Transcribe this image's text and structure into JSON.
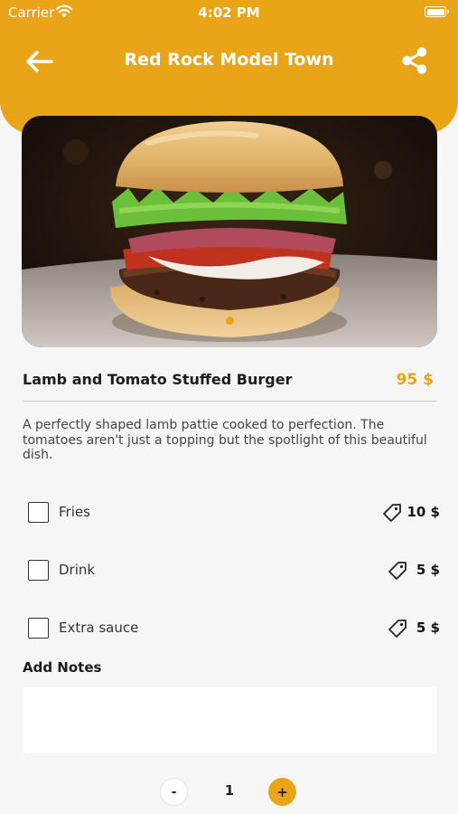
{
  "status_bar": {
    "carrier": "Carrier",
    "time": "4:02 PM"
  },
  "header": {
    "title": "Red Rock Model Town",
    "back_icon": "arrow-left-icon",
    "share_icon": "share-icon"
  },
  "colors": {
    "accent": "#eaa417",
    "background": "#f6f6f6"
  },
  "product": {
    "name": "Lamb and Tomato Stuffed Burger",
    "price": "95 $",
    "description": "A perfectly shaped lamb pattie cooked to perfection. The tomatoes aren't just a topping but the spotlight of this beautiful dish.",
    "image_icon": "burger-photo"
  },
  "addons": [
    {
      "label": "Fries",
      "price": "10 $",
      "checked": false
    },
    {
      "label": "Drink",
      "price": "5 $",
      "checked": false
    },
    {
      "label": "Extra sauce",
      "price": "5 $",
      "checked": false
    }
  ],
  "notes": {
    "label": "Add Notes",
    "placeholder": ""
  },
  "quantity": {
    "minus": "-",
    "value": "1",
    "plus": "+"
  }
}
